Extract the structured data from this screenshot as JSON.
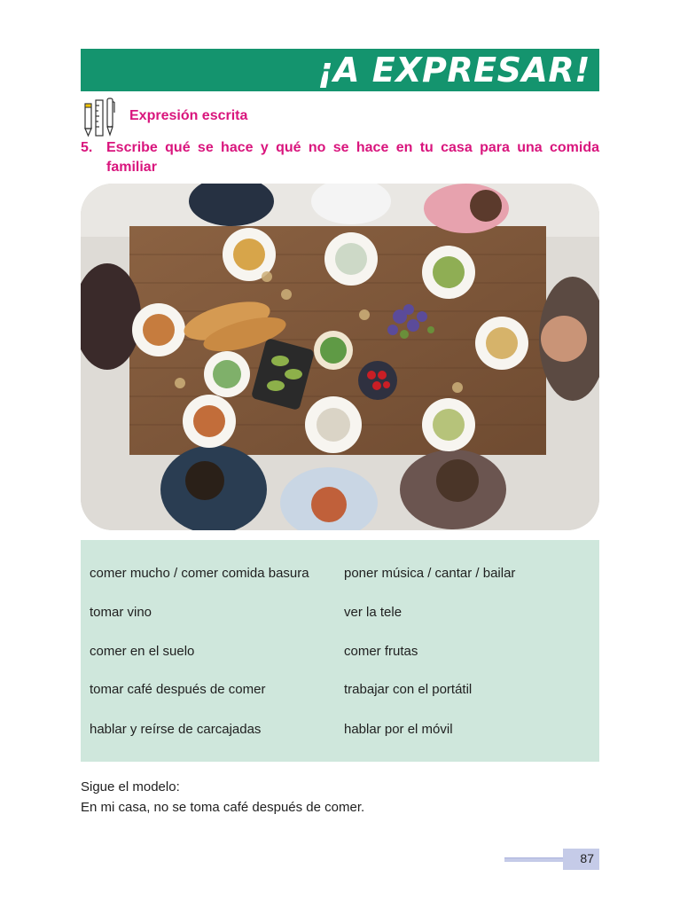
{
  "banner": {
    "title": "¡A EXPRESAR!",
    "color": "#14946e"
  },
  "section": {
    "icon": "pencil-ruler-pen-icon",
    "label": "Expresión escrita",
    "color": "#d9157d"
  },
  "task": {
    "number": "5.",
    "text": "Escribe qué se hace y qué no se hace en tu casa para una comida familiar"
  },
  "photo": {
    "subject": "family-meal-photo"
  },
  "phrases": {
    "left": [
      "comer mucho / comer comida basura",
      "tomar vino",
      "comer en el suelo",
      "tomar café después de comer",
      "hablar y reírse de carcajadas"
    ],
    "right": [
      "poner música / cantar / bailar",
      "ver la tele",
      "comer frutas",
      "trabajar con el portátil",
      "hablar por el móvil"
    ],
    "background": "#cfe7dc"
  },
  "model": {
    "label": "Sigue el modelo:",
    "example": "En mi casa, no se toma café después de comer."
  },
  "footer": {
    "page_number": "87"
  }
}
